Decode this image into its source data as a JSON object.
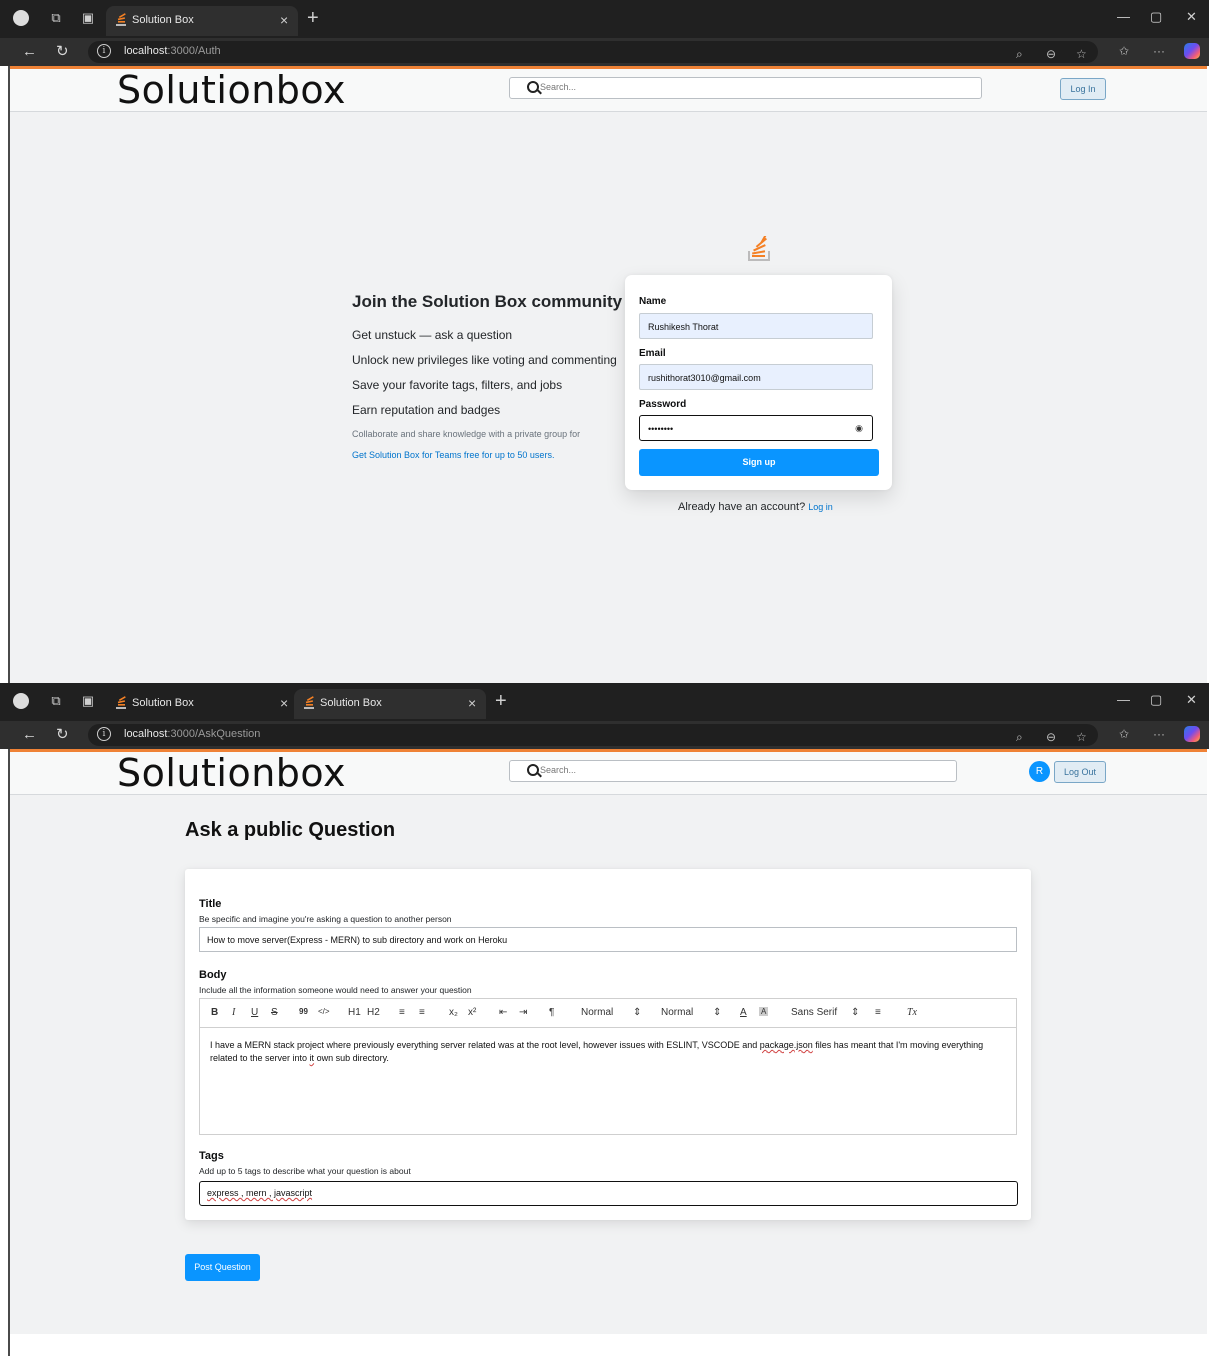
{
  "window1": {
    "tabs": [
      {
        "title": "Solution Box"
      }
    ],
    "url_host": "localhost",
    "url_rest": ":3000/Auth",
    "navbar": {
      "logo": "Solutionbox",
      "search_placeholder": "Search...",
      "login_label": "Log In"
    },
    "join": {
      "heading": "Join the Solution Box community",
      "items": [
        "Get unstuck — ask a question",
        "Unlock new privileges like voting and commenting",
        "Save your favorite tags, filters, and jobs",
        "Earn reputation and badges"
      ],
      "small": "Collaborate and share knowledge with a private group for",
      "link": "Get Solution Box for Teams free for up to 50 users."
    },
    "form": {
      "name_label": "Name",
      "name_value": "Rushikesh Thorat",
      "email_label": "Email",
      "email_value": "rushithorat3010@gmail.com",
      "password_label": "Password",
      "password_value": "••••••••",
      "signup_label": "Sign up"
    },
    "already_text": "Already have an account?",
    "already_link": "Log in"
  },
  "window2": {
    "tabs": [
      {
        "title": "Solution Box"
      },
      {
        "title": "Solution Box"
      }
    ],
    "url_host": "localhost",
    "url_rest": ":3000/AskQuestion",
    "navbar": {
      "logo": "Solutionbox",
      "search_placeholder": "Search...",
      "avatar": "R",
      "logout_label": "Log Out"
    },
    "ask": {
      "heading": "Ask a public Question",
      "title_label": "Title",
      "title_help": "Be specific and imagine you're asking a question to another person",
      "title_value": "How to move server(Express - MERN) to sub directory and work on Heroku",
      "body_label": "Body",
      "body_help": "Include all the information someone would need to answer your question",
      "toolbar": [
        "B",
        "I",
        "U",
        "S",
        "99",
        "</>",
        "H1",
        "H2",
        "≡",
        "≡",
        "x₂",
        "x²",
        "⇤",
        "⇥",
        "¶",
        "Normal",
        "Normal",
        "A",
        "A",
        "Sans Serif",
        "≡",
        "Tx"
      ],
      "body_value_1": "I have a MERN stack project where previously everything server related was at the root level, however issues with ESLINT, VSCODE and ",
      "body_value_spell": "package.json",
      "body_value_2": " files has meant that I'm moving everything related to the server into ",
      "body_value_it": "it",
      "body_value_3": " own sub directory.",
      "tags_label": "Tags",
      "tags_help": "Add up to 5 tags to describe what your question is about",
      "tags_value": "express , mern , javascript",
      "post_label": "Post Question"
    }
  },
  "colors": {
    "accent": "#0a95ff",
    "brand_orange": "#ef8236",
    "page_bg": "#f1f2f3"
  }
}
